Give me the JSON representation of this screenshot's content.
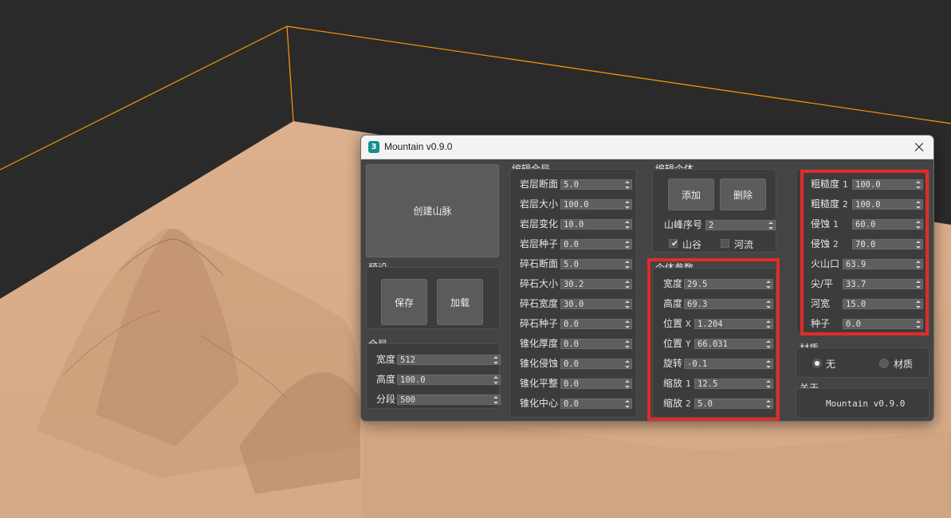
{
  "scene": {
    "terrain_color": "#d8ad89",
    "background_color": "#2a2a2a",
    "bounding_box_color": "#ff9a00"
  },
  "window": {
    "title": "Mountain v0.9.0",
    "icon_glyph": "3",
    "close_icon": "close-icon"
  },
  "create_button": "创建山脉",
  "presets": {
    "label": "预设",
    "save": "保存",
    "load": "加载"
  },
  "global_settings": {
    "label": "全局",
    "fields": [
      {
        "label": "宽度",
        "value": "512"
      },
      {
        "label": "高度",
        "value": "100.0"
      },
      {
        "label": "分段",
        "value": "500"
      }
    ]
  },
  "edit_global": {
    "label": "编辑全局",
    "fields": [
      {
        "label": "岩层断面",
        "value": "5.0"
      },
      {
        "label": "岩层大小",
        "value": "100.0"
      },
      {
        "label": "岩层变化",
        "value": "10.0"
      },
      {
        "label": "岩层种子",
        "value": "0.0"
      },
      {
        "label": "碎石断面",
        "value": "5.0"
      },
      {
        "label": "碎石大小",
        "value": "30.2"
      },
      {
        "label": "碎石宽度",
        "value": "30.0"
      },
      {
        "label": "碎石种子",
        "value": "0.0"
      },
      {
        "label": "锥化厚度",
        "value": "0.0"
      },
      {
        "label": "锥化侵蚀",
        "value": "0.0"
      },
      {
        "label": "锥化平整",
        "value": "0.0"
      },
      {
        "label": "锥化中心",
        "value": "0.0"
      }
    ]
  },
  "edit_individual": {
    "label": "编辑个体",
    "add": "添加",
    "delete": "删除",
    "peak_index_label": "山峰序号",
    "peak_index_value": "2",
    "valley": {
      "label": "山谷",
      "checked": true,
      "check_glyph": "✔"
    },
    "river": {
      "label": "河流",
      "checked": false
    }
  },
  "individual_params": {
    "label": "个体参数",
    "fields": [
      {
        "label": "宽度",
        "sub": "",
        "value": "29.5"
      },
      {
        "label": "高度",
        "sub": "",
        "value": "69.3"
      },
      {
        "label": "位置",
        "sub": "X",
        "value": "1.204"
      },
      {
        "label": "位置",
        "sub": "Y",
        "value": "66.031"
      },
      {
        "label": "旋转",
        "sub": "",
        "value": "-0.1"
      },
      {
        "label": "缩放",
        "sub": "1",
        "value": "12.5"
      },
      {
        "label": "缩放",
        "sub": "2",
        "value": "5.0"
      }
    ]
  },
  "terrain_params": {
    "fields": [
      {
        "label": "粗糙度",
        "sub": "1",
        "value": "100.0"
      },
      {
        "label": "粗糙度",
        "sub": "2",
        "value": "100.0"
      },
      {
        "label": "侵蚀",
        "sub": "1",
        "value": "60.0"
      },
      {
        "label": "侵蚀",
        "sub": "2",
        "value": "70.0"
      },
      {
        "label": "火山口",
        "sub": "",
        "value": "63.9"
      },
      {
        "label": "尖/平",
        "sub": "",
        "value": "33.7"
      },
      {
        "label": "河宽",
        "sub": "",
        "value": "15.0"
      },
      {
        "label": "种子",
        "sub": "",
        "value": "0.0"
      }
    ]
  },
  "material": {
    "label": "材质",
    "options": [
      {
        "label": "无",
        "selected": true
      },
      {
        "label": "材质",
        "selected": false
      }
    ]
  },
  "about": {
    "label": "关于",
    "text": "Mountain v0.9.0"
  },
  "highlight_color": "#e02b2b"
}
